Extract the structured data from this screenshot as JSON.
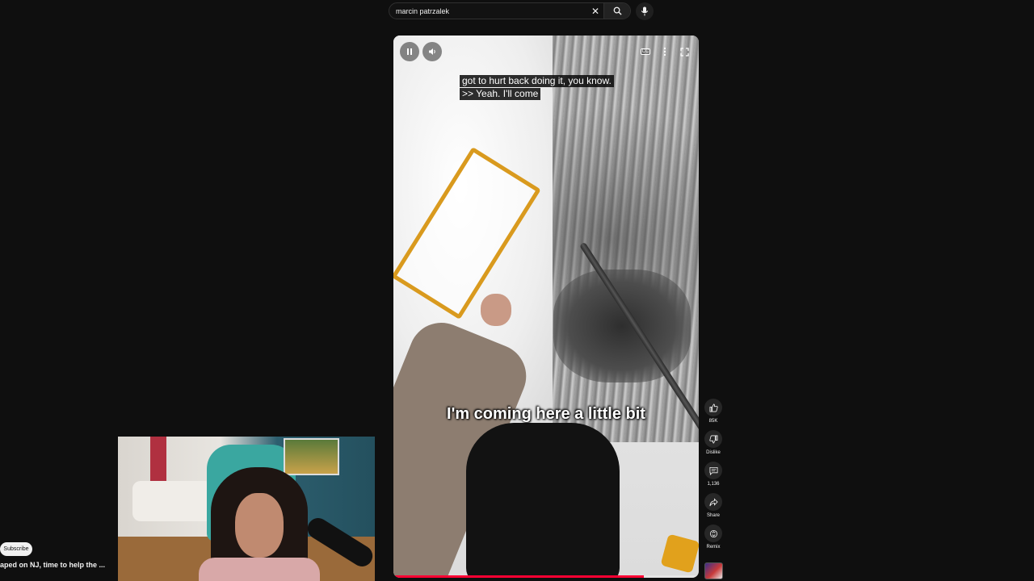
{
  "search": {
    "value": "marcin patrzalek",
    "clear_icon": "close-icon",
    "search_icon": "search-icon",
    "mic_icon": "microphone-icon"
  },
  "player": {
    "controls": {
      "pause_icon": "pause-icon",
      "volume_icon": "volume-icon",
      "cc_label": "CC",
      "more_icon": "more-vert-icon",
      "fullscreen_icon": "fullscreen-icon"
    },
    "caption_lines": [
      "got to hurt back doing it, you know.",
      ">> Yeah. I'll come"
    ],
    "burned_caption": "I'm coming here a little bit",
    "progress_fraction": 0.82,
    "progress_color": "#ff0033"
  },
  "actions": [
    {
      "icon": "like-icon",
      "label": "85K"
    },
    {
      "icon": "dislike-icon",
      "label": "Dislike"
    },
    {
      "icon": "comment-icon",
      "label": "1,136"
    },
    {
      "icon": "share-icon",
      "label": "Share"
    },
    {
      "icon": "remix-icon",
      "label": "Remix"
    }
  ],
  "channel_avatar": "channel-avatar",
  "overlay": {
    "subscribe_label": "Subscribe",
    "video_title": "aped on NJ, time to help the ..."
  }
}
